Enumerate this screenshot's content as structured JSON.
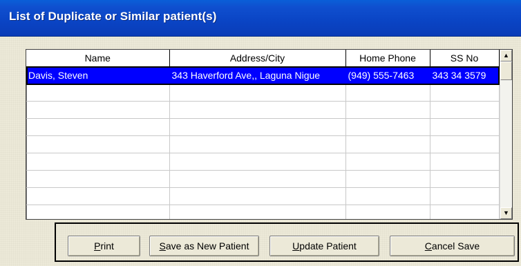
{
  "window": {
    "title": "List of Duplicate or Similar patient(s)"
  },
  "list": {
    "columns": [
      "Name",
      "Address/City",
      "Home Phone",
      "SS No"
    ],
    "rows": [
      {
        "name": "Davis, Steven",
        "address": "343 Haverford Ave,, Laguna Nigue",
        "phone": "(949) 555-7463",
        "ssn": "343 34 3579",
        "selected": true
      }
    ],
    "empty_row_count": 8
  },
  "scrollbar": {
    "up_glyph": "▲",
    "down_glyph": "▼"
  },
  "buttons": {
    "print": {
      "mnemonic": "P",
      "rest": "rint"
    },
    "save_new": {
      "mnemonic": "S",
      "rest": "ave as New Patient"
    },
    "update": {
      "mnemonic": "U",
      "rest": "pdate Patient"
    },
    "cancel": {
      "mnemonic": "C",
      "rest": "ancel Save"
    }
  }
}
